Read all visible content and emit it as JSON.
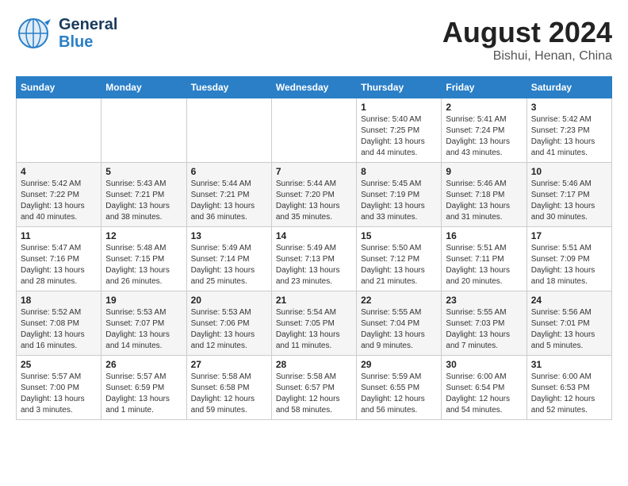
{
  "brand": {
    "name_general": "General",
    "name_blue": "Blue",
    "tagline": "GeneralBlue"
  },
  "header": {
    "month_year": "August 2024",
    "location": "Bishui, Henan, China"
  },
  "weekdays": [
    "Sunday",
    "Monday",
    "Tuesday",
    "Wednesday",
    "Thursday",
    "Friday",
    "Saturday"
  ],
  "weeks": [
    [
      {
        "day": "",
        "sunrise": "",
        "sunset": "",
        "daylight": ""
      },
      {
        "day": "",
        "sunrise": "",
        "sunset": "",
        "daylight": ""
      },
      {
        "day": "",
        "sunrise": "",
        "sunset": "",
        "daylight": ""
      },
      {
        "day": "",
        "sunrise": "",
        "sunset": "",
        "daylight": ""
      },
      {
        "day": "1",
        "sunrise": "Sunrise: 5:40 AM",
        "sunset": "Sunset: 7:25 PM",
        "daylight": "Daylight: 13 hours and 44 minutes."
      },
      {
        "day": "2",
        "sunrise": "Sunrise: 5:41 AM",
        "sunset": "Sunset: 7:24 PM",
        "daylight": "Daylight: 13 hours and 43 minutes."
      },
      {
        "day": "3",
        "sunrise": "Sunrise: 5:42 AM",
        "sunset": "Sunset: 7:23 PM",
        "daylight": "Daylight: 13 hours and 41 minutes."
      }
    ],
    [
      {
        "day": "4",
        "sunrise": "Sunrise: 5:42 AM",
        "sunset": "Sunset: 7:22 PM",
        "daylight": "Daylight: 13 hours and 40 minutes."
      },
      {
        "day": "5",
        "sunrise": "Sunrise: 5:43 AM",
        "sunset": "Sunset: 7:21 PM",
        "daylight": "Daylight: 13 hours and 38 minutes."
      },
      {
        "day": "6",
        "sunrise": "Sunrise: 5:44 AM",
        "sunset": "Sunset: 7:21 PM",
        "daylight": "Daylight: 13 hours and 36 minutes."
      },
      {
        "day": "7",
        "sunrise": "Sunrise: 5:44 AM",
        "sunset": "Sunset: 7:20 PM",
        "daylight": "Daylight: 13 hours and 35 minutes."
      },
      {
        "day": "8",
        "sunrise": "Sunrise: 5:45 AM",
        "sunset": "Sunset: 7:19 PM",
        "daylight": "Daylight: 13 hours and 33 minutes."
      },
      {
        "day": "9",
        "sunrise": "Sunrise: 5:46 AM",
        "sunset": "Sunset: 7:18 PM",
        "daylight": "Daylight: 13 hours and 31 minutes."
      },
      {
        "day": "10",
        "sunrise": "Sunrise: 5:46 AM",
        "sunset": "Sunset: 7:17 PM",
        "daylight": "Daylight: 13 hours and 30 minutes."
      }
    ],
    [
      {
        "day": "11",
        "sunrise": "Sunrise: 5:47 AM",
        "sunset": "Sunset: 7:16 PM",
        "daylight": "Daylight: 13 hours and 28 minutes."
      },
      {
        "day": "12",
        "sunrise": "Sunrise: 5:48 AM",
        "sunset": "Sunset: 7:15 PM",
        "daylight": "Daylight: 13 hours and 26 minutes."
      },
      {
        "day": "13",
        "sunrise": "Sunrise: 5:49 AM",
        "sunset": "Sunset: 7:14 PM",
        "daylight": "Daylight: 13 hours and 25 minutes."
      },
      {
        "day": "14",
        "sunrise": "Sunrise: 5:49 AM",
        "sunset": "Sunset: 7:13 PM",
        "daylight": "Daylight: 13 hours and 23 minutes."
      },
      {
        "day": "15",
        "sunrise": "Sunrise: 5:50 AM",
        "sunset": "Sunset: 7:12 PM",
        "daylight": "Daylight: 13 hours and 21 minutes."
      },
      {
        "day": "16",
        "sunrise": "Sunrise: 5:51 AM",
        "sunset": "Sunset: 7:11 PM",
        "daylight": "Daylight: 13 hours and 20 minutes."
      },
      {
        "day": "17",
        "sunrise": "Sunrise: 5:51 AM",
        "sunset": "Sunset: 7:09 PM",
        "daylight": "Daylight: 13 hours and 18 minutes."
      }
    ],
    [
      {
        "day": "18",
        "sunrise": "Sunrise: 5:52 AM",
        "sunset": "Sunset: 7:08 PM",
        "daylight": "Daylight: 13 hours and 16 minutes."
      },
      {
        "day": "19",
        "sunrise": "Sunrise: 5:53 AM",
        "sunset": "Sunset: 7:07 PM",
        "daylight": "Daylight: 13 hours and 14 minutes."
      },
      {
        "day": "20",
        "sunrise": "Sunrise: 5:53 AM",
        "sunset": "Sunset: 7:06 PM",
        "daylight": "Daylight: 13 hours and 12 minutes."
      },
      {
        "day": "21",
        "sunrise": "Sunrise: 5:54 AM",
        "sunset": "Sunset: 7:05 PM",
        "daylight": "Daylight: 13 hours and 11 minutes."
      },
      {
        "day": "22",
        "sunrise": "Sunrise: 5:55 AM",
        "sunset": "Sunset: 7:04 PM",
        "daylight": "Daylight: 13 hours and 9 minutes."
      },
      {
        "day": "23",
        "sunrise": "Sunrise: 5:55 AM",
        "sunset": "Sunset: 7:03 PM",
        "daylight": "Daylight: 13 hours and 7 minutes."
      },
      {
        "day": "24",
        "sunrise": "Sunrise: 5:56 AM",
        "sunset": "Sunset: 7:01 PM",
        "daylight": "Daylight: 13 hours and 5 minutes."
      }
    ],
    [
      {
        "day": "25",
        "sunrise": "Sunrise: 5:57 AM",
        "sunset": "Sunset: 7:00 PM",
        "daylight": "Daylight: 13 hours and 3 minutes."
      },
      {
        "day": "26",
        "sunrise": "Sunrise: 5:57 AM",
        "sunset": "Sunset: 6:59 PM",
        "daylight": "Daylight: 13 hours and 1 minute."
      },
      {
        "day": "27",
        "sunrise": "Sunrise: 5:58 AM",
        "sunset": "Sunset: 6:58 PM",
        "daylight": "Daylight: 12 hours and 59 minutes."
      },
      {
        "day": "28",
        "sunrise": "Sunrise: 5:58 AM",
        "sunset": "Sunset: 6:57 PM",
        "daylight": "Daylight: 12 hours and 58 minutes."
      },
      {
        "day": "29",
        "sunrise": "Sunrise: 5:59 AM",
        "sunset": "Sunset: 6:55 PM",
        "daylight": "Daylight: 12 hours and 56 minutes."
      },
      {
        "day": "30",
        "sunrise": "Sunrise: 6:00 AM",
        "sunset": "Sunset: 6:54 PM",
        "daylight": "Daylight: 12 hours and 54 minutes."
      },
      {
        "day": "31",
        "sunrise": "Sunrise: 6:00 AM",
        "sunset": "Sunset: 6:53 PM",
        "daylight": "Daylight: 12 hours and 52 minutes."
      }
    ]
  ]
}
